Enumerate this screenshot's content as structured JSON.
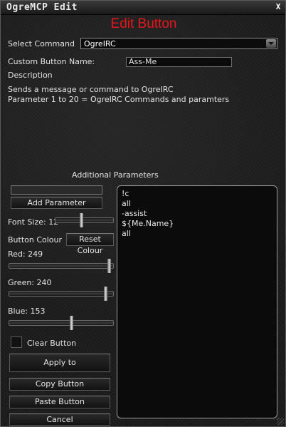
{
  "window": {
    "title": "OgreMCP Edit",
    "close_label": "X"
  },
  "heading": "Edit Button",
  "select_command": {
    "label": "Select Command",
    "value": "OgreIRC"
  },
  "custom_name": {
    "label": "Custom Button Name:",
    "value": "Ass-Me"
  },
  "description": {
    "label": "Description",
    "lines": [
      "Sends a message or command to OgreIRC",
      "Parameter 1 to 20 = OgreIRC Commands and paramters"
    ]
  },
  "additional_parameters": {
    "label": "Additional Parameters",
    "new_param_value": "",
    "add_button": "Add Parameter",
    "items": [
      "!c",
      "all",
      "-assist",
      "${Me.Name}",
      "all"
    ]
  },
  "font_size": {
    "label": "Font Size: 12",
    "value": 12,
    "fraction": 0.45
  },
  "button_colour": {
    "label": "Button Colour",
    "reset_label": "Reset Colour"
  },
  "red": {
    "label": "Red: 249",
    "value": 249,
    "max": 255
  },
  "green": {
    "label": "Green: 240",
    "value": 240,
    "max": 255
  },
  "blue": {
    "label": "Blue: 153",
    "value": 153,
    "max": 255
  },
  "clear_button": {
    "label": "Clear Button",
    "checked": false
  },
  "actions": {
    "apply": "Apply to",
    "copy": "Copy Button",
    "paste": "Paste Button",
    "cancel": "Cancel"
  },
  "colors": {
    "heading": "#e8161a",
    "background": "#1c1c1c",
    "border": "#9a9a9a"
  }
}
